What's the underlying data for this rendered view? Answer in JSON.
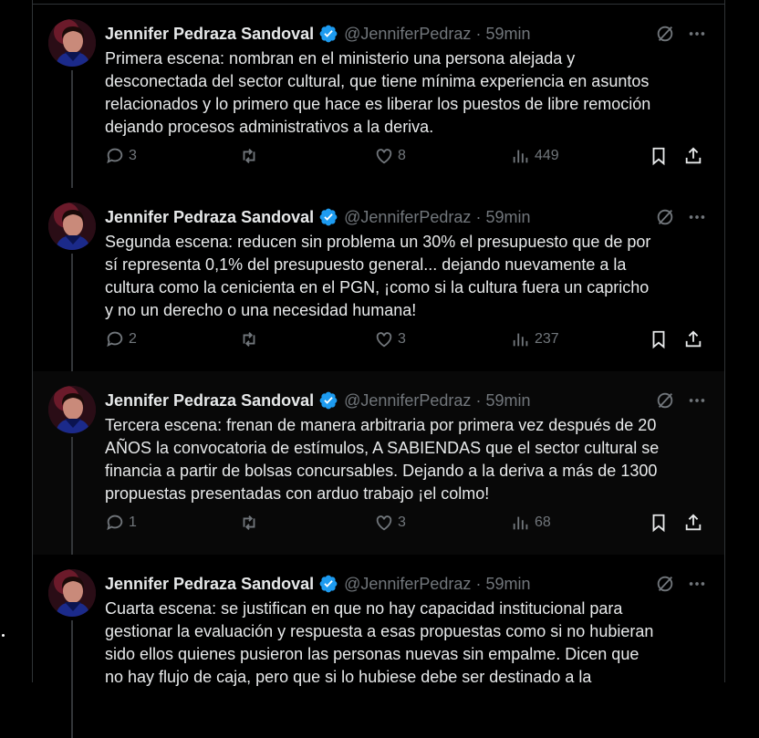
{
  "colors": {
    "background": "#000000",
    "text": "#e7e9ea",
    "muted": "#71767b",
    "verified": "#1d9bf0",
    "border": "#2f3336"
  },
  "tweets": [
    {
      "author": "Jennifer Pedraza Sandoval",
      "handle": "@JenniferPedraz",
      "time": "59min",
      "lines": [
        "Primera escena: nombran en el ministerio una persona alejada y",
        "desconectada del sector cultural, que tiene mínima experiencia en asuntos",
        "relacionados y lo primero que hace es liberar los puestos de libre remoción",
        "dejando procesos administrativos a la deriva."
      ],
      "replies": "3",
      "reposts": "",
      "likes": "8",
      "views": "449"
    },
    {
      "author": "Jennifer Pedraza Sandoval",
      "handle": "@JenniferPedraz",
      "time": "59min",
      "lines": [
        "Segunda escena: reducen sin problema un 30% el presupuesto que de por",
        "sí representa 0,1% del presupuesto general... dejando nuevamente a la",
        "cultura como la cenicienta en el PGN, ¡como si la cultura fuera un capricho",
        "y no un derecho o una necesidad humana!"
      ],
      "replies": "2",
      "reposts": "",
      "likes": "3",
      "views": "237"
    },
    {
      "author": "Jennifer Pedraza Sandoval",
      "handle": "@JenniferPedraz",
      "time": "59min",
      "lines": [
        "Tercera escena: frenan de manera arbitraria por primera vez después de 20",
        "AÑOS la convocatoria de estímulos, A SABIENDAS que el sector cultural se",
        "financia a partir de bolsas concursables. Dejando a la deriva a más de 1300",
        "propuestas presentadas con arduo trabajo ¡el colmo!"
      ],
      "replies": "1",
      "reposts": "",
      "likes": "3",
      "views": "68"
    },
    {
      "author": "Jennifer Pedraza Sandoval",
      "handle": "@JenniferPedraz",
      "time": "59min",
      "lines": [
        "Cuarta escena: se justifican en que no hay capacidad institucional para",
        "gestionar la evaluación y respuesta a esas propuestas como si no hubieran",
        "sido ellos quienes pusieron las personas nuevas sin empalme. Dicen que",
        "no hay flujo de caja, pero que si lo hubiese debe ser destinado a la"
      ],
      "replies": "",
      "reposts": "",
      "likes": "",
      "views": ""
    }
  ],
  "icons": {
    "verified": "verified-badge-icon",
    "grok": "grok-icon",
    "more": "more-icon",
    "reply": "reply-icon",
    "repost": "repost-icon",
    "like": "like-icon",
    "views": "views-icon",
    "bookmark": "bookmark-icon",
    "share": "share-icon"
  }
}
